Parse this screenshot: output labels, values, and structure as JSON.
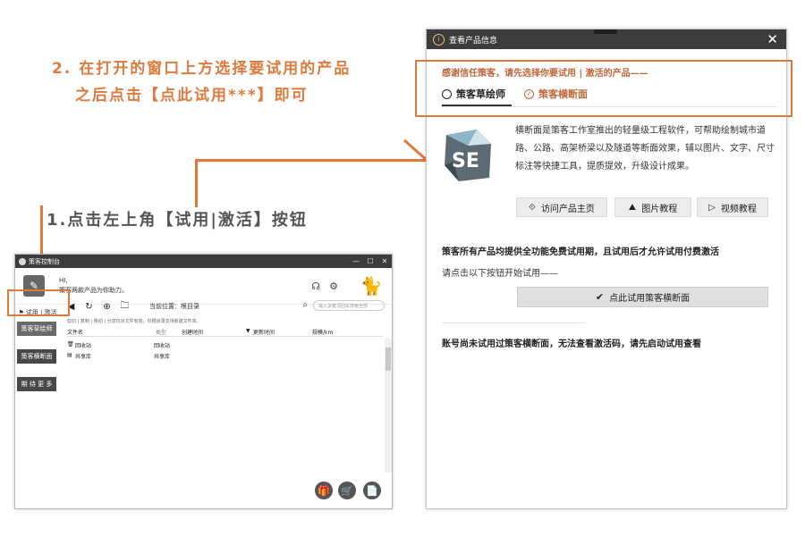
{
  "step2": {
    "line1": "2. 在打开的窗口上方选择要试用的产品",
    "line2": "之后点击【点此试用***】即可"
  },
  "step1": {
    "text": "1.点击左上角【试用|激活】按钮"
  },
  "app": {
    "title": "策客控制台",
    "greeting_line1": "HI,",
    "greeting_line2": "策客两款产品为你助力。",
    "try_activate": "试用 | 激活",
    "sidebar": [
      {
        "label": "策客草绘师"
      },
      {
        "label": "策客横断面"
      },
      {
        "label": "期 待 更 多"
      }
    ],
    "location_label": "当前位置：根目录",
    "search_placeholder": "输入关键词回车搜索全部",
    "hint": "剪切 | 复制 | 移动 | 分享仅对文件有效。仅根目录支持新建文件夹。",
    "columns": [
      "文件名",
      "类型",
      "创建时间",
      "更新时间",
      "规模/km"
    ],
    "rows": [
      {
        "name": "回收站",
        "type": "回收站"
      },
      {
        "name": "共享库",
        "type": "共享库"
      }
    ]
  },
  "dialog": {
    "title": "查看产品信息",
    "thanks": "感谢信任策客，请先选择你要试用 | 激活的产品——",
    "tabs": [
      {
        "label": "策客草绘师"
      },
      {
        "label": "策客横断面"
      }
    ],
    "logo_text": "SE",
    "description": "横断面是策客工作室推出的轻量级工程软件，可帮助绘制城市道路、公路、高架桥梁以及隧道等断面效果，辅以图片、文字、尺寸标注等快捷工具，提质提效，升级设计成果。",
    "links": [
      {
        "label": "访问产品主页"
      },
      {
        "label": "图片教程"
      },
      {
        "label": "视频教程"
      }
    ],
    "all_free": "策客所有产品均提供全功能免费试用期，且试用后才允许试用付费激活",
    "click_hint": "请点击以下按钮开始试用——",
    "try_button": "点此试用策客横断面",
    "not_activated": "账号尚未试用过策客横断面，无法查看激活码，请先启动试用查看"
  },
  "colors": {
    "accent": "#e07a3c",
    "titlebar": "#3c3c3c",
    "brand_text": "#c0653a"
  }
}
